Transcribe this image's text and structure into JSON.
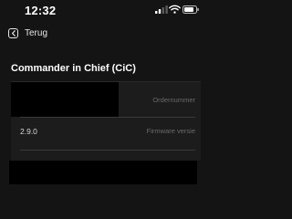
{
  "status_bar": {
    "time": "12:32",
    "icons": [
      "signal-icon",
      "wifi-icon",
      "battery-icon"
    ]
  },
  "nav": {
    "back_label": "Terug",
    "back_icon": "chevron-left-icon"
  },
  "page": {
    "title": "Commander in Chief (CiC)"
  },
  "info_rows": [
    {
      "label": "Ordernummer",
      "value": ""
    },
    {
      "label": "Firmware versie",
      "value": "2.9.0"
    }
  ],
  "colors": {
    "background": "#141414",
    "card": "#1c1c1c",
    "label": "#6a6a6a",
    "text": "#ffffff"
  }
}
